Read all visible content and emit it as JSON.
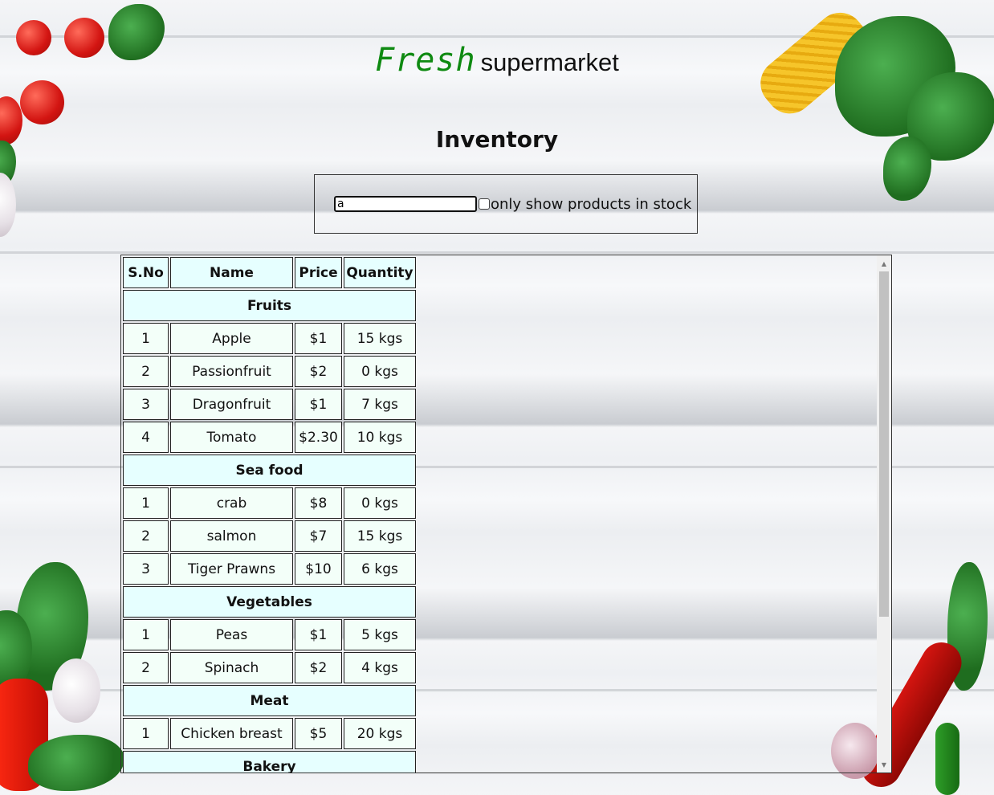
{
  "brand": {
    "fresh": "Fresh",
    "supermarket": "supermarket"
  },
  "page_title": "Inventory",
  "filter": {
    "search_value": "a",
    "search_placeholder": "",
    "stock_checked": false,
    "stock_label": "only show products in stock"
  },
  "table": {
    "headers": [
      "S.No",
      "Name",
      "Price",
      "Quantity"
    ],
    "groups": [
      {
        "category": "Fruits",
        "items": [
          {
            "sno": "1",
            "name": "Apple",
            "price": "$1",
            "quantity": "15 kgs"
          },
          {
            "sno": "2",
            "name": "Passionfruit",
            "price": "$2",
            "quantity": "0 kgs"
          },
          {
            "sno": "3",
            "name": "Dragonfruit",
            "price": "$1",
            "quantity": "7 kgs"
          },
          {
            "sno": "4",
            "name": "Tomato",
            "price": "$2.30",
            "quantity": "10 kgs"
          }
        ]
      },
      {
        "category": "Sea food",
        "items": [
          {
            "sno": "1",
            "name": "crab",
            "price": "$8",
            "quantity": "0 kgs"
          },
          {
            "sno": "2",
            "name": "salmon",
            "price": "$7",
            "quantity": "15 kgs"
          },
          {
            "sno": "3",
            "name": "Tiger Prawns",
            "price": "$10",
            "quantity": "6 kgs"
          }
        ]
      },
      {
        "category": "Vegetables",
        "items": [
          {
            "sno": "1",
            "name": "Peas",
            "price": "$1",
            "quantity": "5 kgs"
          },
          {
            "sno": "2",
            "name": "Spinach",
            "price": "$2",
            "quantity": "4 kgs"
          }
        ]
      },
      {
        "category": "Meat",
        "items": [
          {
            "sno": "1",
            "name": "Chicken breast",
            "price": "$5",
            "quantity": "20 kgs"
          }
        ]
      },
      {
        "category": "Bakery",
        "items": []
      }
    ]
  },
  "colors": {
    "brand_green": "#0f8a12",
    "header_cell_bg": "#e6ffff",
    "row_cell_bg": "#f3fff9"
  },
  "icons": [
    "scroll-up-arrow-icon",
    "scroll-down-arrow-icon"
  ]
}
